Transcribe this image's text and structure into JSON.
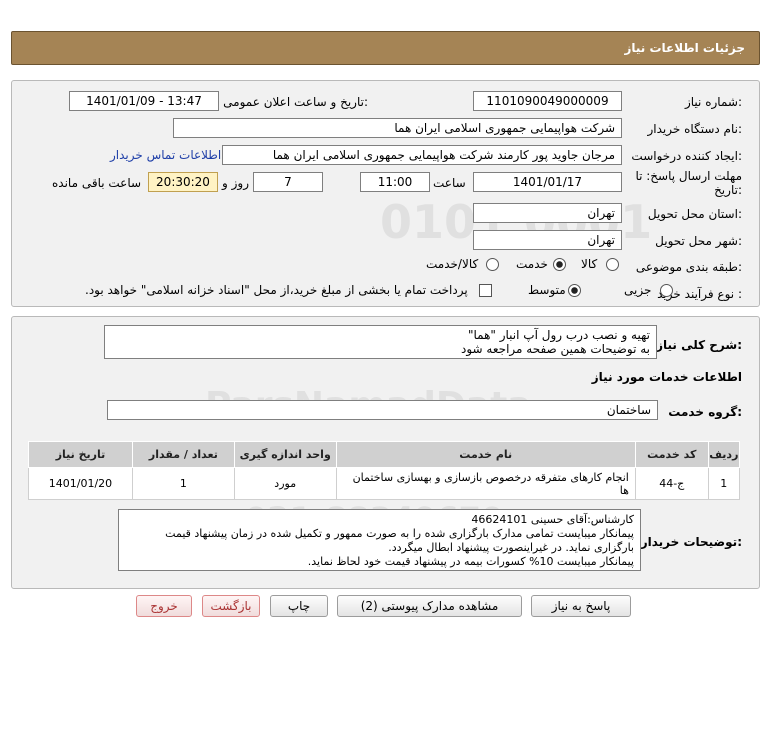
{
  "header": {
    "title": "جزئیات اطلاعات نیاز"
  },
  "need_number": {
    "label": "شماره نیاز:",
    "value": "1101090049000009"
  },
  "announce": {
    "label": "تاریخ و ساعت اعلان عمومی:",
    "value": "1401/01/09 - 13:47"
  },
  "buyer_org": {
    "label": "نام دستگاه خریدار:",
    "value": "شرکت هواپیمایی جمهوری اسلامی ایران هما"
  },
  "requester": {
    "label": "ایجاد کننده درخواست:",
    "value": "مرجان جاوید پور کارمند شرکت هواپیمایی جمهوری اسلامی ایران هما",
    "contact_link": "اطلاعات تماس خریدار"
  },
  "deadline": {
    "label_line1": "مهلت ارسال پاسخ: تا",
    "label_line2": "تاریخ:",
    "date": "1401/01/17",
    "time_label": "ساعت",
    "time": "11:00",
    "days": "7",
    "days_label": "روز و",
    "remaining": "20:30:20",
    "remaining_label": "ساعت باقی مانده"
  },
  "province": {
    "label": "استان محل تحویل:",
    "value": "تهران"
  },
  "city": {
    "label": "شهر محل تحویل:",
    "value": "تهران"
  },
  "category": {
    "label": "طبقه بندی موضوعی:",
    "options": [
      "کالا",
      "خدمت",
      "کالا/خدمت"
    ],
    "selected": "خدمت"
  },
  "purchase_type": {
    "label": "نوع فرآیند خرید :",
    "options": [
      "جزیی",
      "متوسط"
    ],
    "selected": "متوسط",
    "treasury_note": "پرداخت تمام یا بخشی از مبلغ خرید،از محل \"اسناد خزانه اسلامی\" خواهد بود."
  },
  "description": {
    "label": "شرح کلی نیاز:",
    "line1": "تهیه و نصب درب رول آپ انبار \"هما\"",
    "line2": "به توضیحات همین صفحه مراجعه شود"
  },
  "services_info": {
    "title": "اطلاعات خدمات مورد نیاز"
  },
  "service_group": {
    "label": "گروه خدمت:",
    "value": "ساختمان"
  },
  "table": {
    "headers": [
      "ردیف",
      "کد خدمت",
      "نام خدمت",
      "واحد اندازه گیری",
      "تعداد / مقدار",
      "تاریخ نیاز"
    ],
    "rows": [
      [
        "1",
        "ج-44",
        "انجام کارهای متفرقه درخصوص بازسازی و بهسازی ساختمان ها",
        "مورد",
        "1",
        "1401/01/20"
      ]
    ]
  },
  "buyer_notes": {
    "label": "توضیحات خریدار:",
    "lines": [
      "کارشناس:آقای حسینی 46624101",
      "پیمانکار میبایست تمامی مدارک بارگزاری شده را به صورت ممهور و تکمیل شده در زمان پیشنهاد قیمت بارگزاری نماید. در غیراینصورت پیشنهاد ابطال میگردد.",
      "پیمانکار میبایست 10% کسورات بیمه در پیشنهاد قیمت خود لحاظ نماید."
    ]
  },
  "buttons": {
    "reply": "پاسخ به نیاز",
    "attachments": "مشاهده مدارک پیوستی (2)",
    "print": "چاپ",
    "back": "بازگشت",
    "exit": "خروج"
  },
  "colors": {
    "header": "#a58455",
    "timer_bg": "#fff3c4",
    "link": "#1f3fa8"
  }
}
